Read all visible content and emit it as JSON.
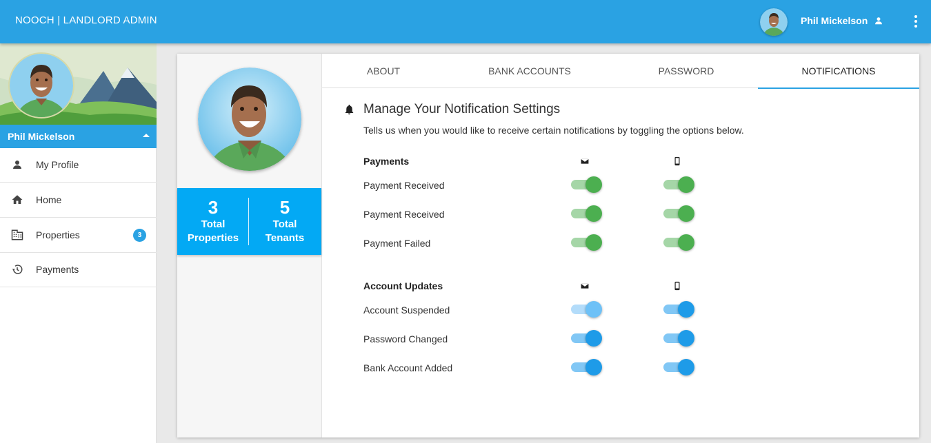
{
  "app": {
    "title": "NOOCH | LANDLORD ADMIN"
  },
  "header": {
    "username": "Phil Mickelson",
    "icons": [
      "avatar",
      "person-icon",
      "more-vert-icon"
    ]
  },
  "sidebar": {
    "username": "Phil Mickelson",
    "items": [
      {
        "label": "My Profile",
        "icon": "person-icon"
      },
      {
        "label": "Home",
        "icon": "home-icon"
      },
      {
        "label": "Properties",
        "icon": "building-icon",
        "badge": "3"
      },
      {
        "label": "Payments",
        "icon": "history-icon"
      }
    ]
  },
  "profile": {
    "stats": [
      {
        "value": "3",
        "label1": "Total",
        "label2": "Properties"
      },
      {
        "value": "5",
        "label1": "Total",
        "label2": "Tenants"
      }
    ]
  },
  "tabs": [
    {
      "label": "ABOUT",
      "active": false
    },
    {
      "label": "BANK ACCOUNTS",
      "active": false
    },
    {
      "label": "PASSWORD",
      "active": false
    },
    {
      "label": "NOTIFICATIONS",
      "active": true
    }
  ],
  "notifications": {
    "title": "Manage Your Notification Settings",
    "subtitle": "Tells us when you would like to receive certain notifications by toggling the options below.",
    "groups": [
      {
        "title": "Payments",
        "rows": [
          {
            "label": "Payment Received",
            "email": true,
            "mobile": true
          },
          {
            "label": "Payment Received",
            "email": true,
            "mobile": true
          },
          {
            "label": "Payment Failed",
            "email": true,
            "mobile": true
          }
        ]
      },
      {
        "title": "Account Updates",
        "rows": [
          {
            "label": "Account Suspended",
            "email": true,
            "mobile": true
          },
          {
            "label": "Password Changed",
            "email": true,
            "mobile": true
          },
          {
            "label": "Bank Account Added",
            "email": true,
            "mobile": true
          }
        ]
      }
    ]
  },
  "colors": {
    "primary": "#2aa2e3",
    "stats": "#03a9f4",
    "toggle_green": "#4caf50",
    "toggle_blue": "#1e9be8"
  }
}
